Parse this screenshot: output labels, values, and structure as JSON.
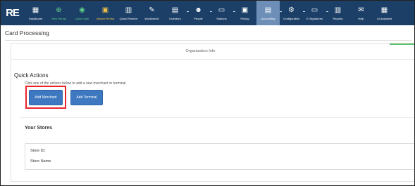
{
  "app": {
    "logo": "RE"
  },
  "nav": [
    {
      "label": "Dashboard",
      "icon": "dashboard-icon",
      "glyph": "▦",
      "tone": ""
    },
    {
      "label": "New Rental",
      "icon": "new-rental-icon",
      "glyph": "⊕",
      "tone": "green"
    },
    {
      "label": "Quick Sale",
      "icon": "quick-sale-icon",
      "glyph": "◉",
      "tone": "green"
    },
    {
      "label": "Missed Rental",
      "icon": "missed-rental-icon",
      "glyph": "▣",
      "tone": "gold"
    },
    {
      "label": "Quick Receive",
      "icon": "quick-receive-icon",
      "glyph": "▥",
      "tone": ""
    },
    {
      "label": "Workbench",
      "icon": "wrench-icon",
      "glyph": "✎",
      "tone": ""
    },
    {
      "label": "Inventory",
      "icon": "inventory-icon",
      "glyph": "▤",
      "tone": ""
    },
    {
      "label": "People",
      "icon": "people-icon",
      "glyph": "☻",
      "tone": ""
    },
    {
      "label": "Stations",
      "icon": "stations-icon",
      "glyph": "▭",
      "tone": ""
    },
    {
      "label": "Pricing",
      "icon": "pricing-icon",
      "glyph": "▣",
      "tone": ""
    },
    {
      "label": "Accounting",
      "icon": "accounting-icon",
      "glyph": "▤",
      "tone": "",
      "active": true
    },
    {
      "label": "Configuration",
      "icon": "configuration-icon",
      "glyph": "⚙",
      "tone": ""
    },
    {
      "label": "E-Signatures",
      "icon": "e-signatures-icon",
      "glyph": "▭",
      "tone": ""
    },
    {
      "label": "Reports",
      "icon": "reports-icon",
      "glyph": "▥",
      "tone": ""
    },
    {
      "label": "Help",
      "icon": "help-icon",
      "glyph": "✉",
      "tone": ""
    },
    {
      "label": "AI Assistant",
      "icon": "ai-assistant-icon",
      "glyph": "▦",
      "tone": ""
    }
  ],
  "page": {
    "title": "Card Processing"
  },
  "tabs": {
    "organization_info": "Organization Info"
  },
  "quick_actions": {
    "title": "Quick Actions",
    "description": "Click one of the actions below to add a new merchant or terminal.",
    "add_merchant": "Add Merchant",
    "add_terminal": "Add Terminal"
  },
  "stores": {
    "title": "Your Stores",
    "store_id_label": "Store ID:",
    "store_name_label": "Store Name"
  }
}
